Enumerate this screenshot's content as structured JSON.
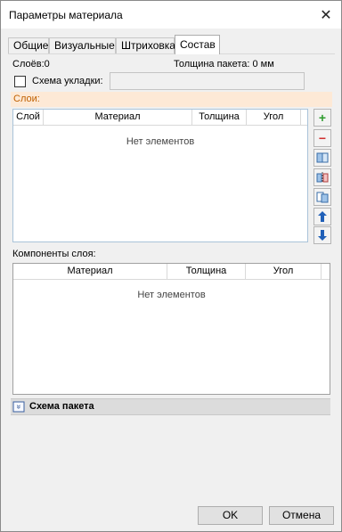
{
  "window": {
    "title": "Параметры материала",
    "close_symbol": "✕"
  },
  "tabs": [
    {
      "label": "Общие"
    },
    {
      "label": "Визуальные"
    },
    {
      "label": "Штриховка"
    },
    {
      "label": "Состав",
      "active": true
    }
  ],
  "summary": {
    "layers_count": "Слоёв:0",
    "package_thickness": "Толщина пакета: 0 мм"
  },
  "layout_scheme": {
    "label": "Схема укладки:",
    "checked": false,
    "value": ""
  },
  "layers_section": {
    "title": "Слои:",
    "columns": [
      "Слой",
      "Материал",
      "Толщина",
      "Угол"
    ],
    "empty_text": "Нет элементов",
    "rows": []
  },
  "layer_buttons": [
    {
      "name": "add-layer-button",
      "icon": "plus-icon",
      "symbol": "+",
      "color": "#2e9b2e"
    },
    {
      "name": "remove-layer-button",
      "icon": "minus-icon",
      "symbol": "−",
      "color": "#d03030"
    },
    {
      "name": "copy-layer-button",
      "icon": "copy-layer-icon"
    },
    {
      "name": "mirror-layer-button",
      "icon": "mirror-layer-icon"
    },
    {
      "name": "paste-layer-button",
      "icon": "paste-layer-icon"
    },
    {
      "name": "move-up-button",
      "icon": "arrow-up-icon",
      "symbol": "🡑",
      "color": "#1f5fb8"
    },
    {
      "name": "move-down-button",
      "icon": "arrow-down-icon",
      "symbol": "🡓",
      "color": "#1f5fb8"
    }
  ],
  "components_section": {
    "title": "Компоненты слоя:",
    "columns": [
      "Материал",
      "Толщина",
      "Угол"
    ],
    "empty_text": "Нет элементов",
    "rows": []
  },
  "package_scheme": {
    "title": "Схема пакета",
    "icon": "double-chevron-down-icon"
  },
  "footer": {
    "ok_label": "OK",
    "cancel_label": "Отмена"
  }
}
